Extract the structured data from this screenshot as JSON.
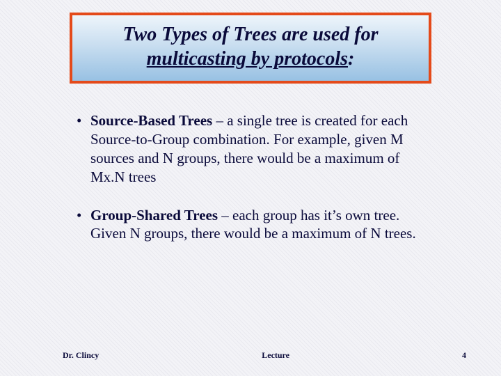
{
  "title": {
    "line1": "Two Types of Trees are used for",
    "line2_underlined": "multicasting by protocols",
    "trailing_colon": ":"
  },
  "bullets": [
    {
      "lead": "Source-Based Trees",
      "rest": " – a single tree is created for each Source-to-Group combination.  For example, given M sources and N groups, there would be a maximum of Mx.N trees"
    },
    {
      "lead": "Group-Shared Trees",
      "rest": " – each group has it’s own tree.  Given N groups, there would be a maximum of N trees."
    }
  ],
  "footer": {
    "author": "Dr. Clincy",
    "center": "Lecture",
    "page": "4"
  }
}
